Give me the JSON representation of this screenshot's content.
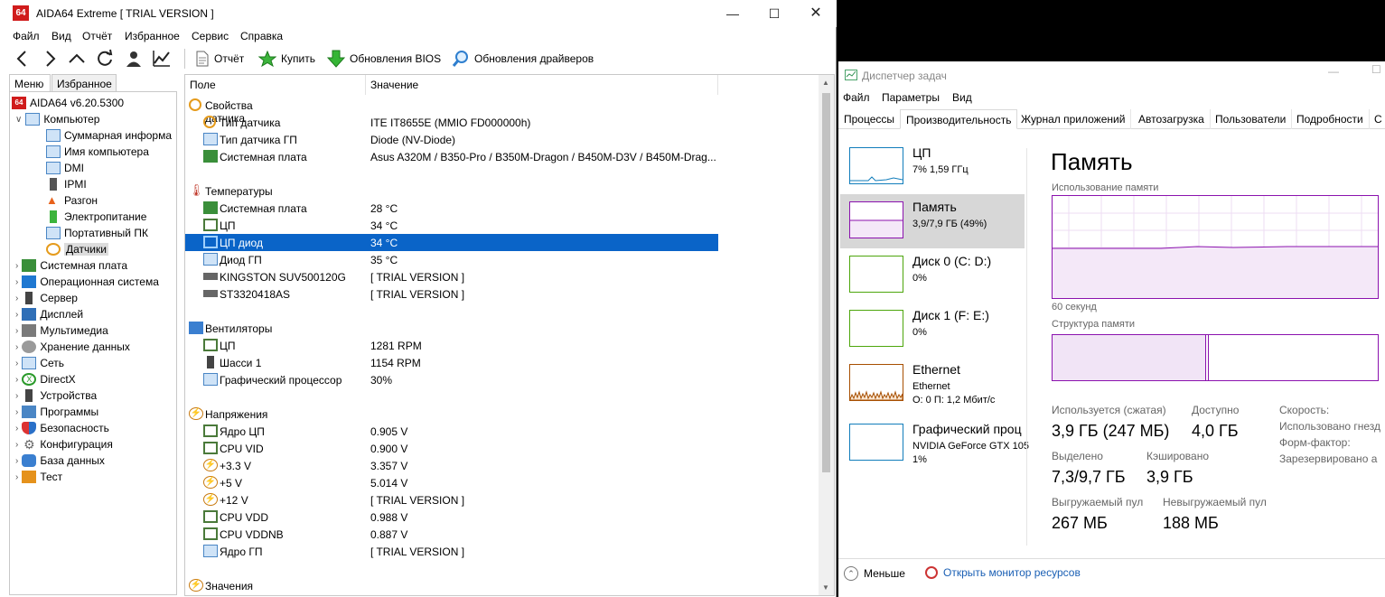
{
  "aida": {
    "title": "AIDA64 Extreme  [ TRIAL VERSION ]",
    "logo": "64",
    "menu": [
      "Файл",
      "Вид",
      "Отчёт",
      "Избранное",
      "Сервис",
      "Справка"
    ],
    "toolbar": {
      "report": "Отчёт",
      "buy": "Купить",
      "bios": "Обновления BIOS",
      "drivers": "Обновления драйверов"
    },
    "left_tabs": [
      "Меню",
      "Избранное"
    ],
    "tree": {
      "root": "AIDA64 v6.20.5300",
      "computer": "Компьютер",
      "children": [
        "Суммарная информа",
        "Имя компьютера",
        "DMI",
        "IPMI",
        "Разгон",
        "Электропитание",
        "Портативный ПК",
        "Датчики"
      ],
      "sections": [
        "Системная плата",
        "Операционная система",
        "Сервер",
        "Дисплей",
        "Мультимедиа",
        "Хранение данных",
        "Сеть",
        "DirectX",
        "Устройства",
        "Программы",
        "Безопасность",
        "Конфигурация",
        "База данных",
        "Тест"
      ]
    },
    "columns": {
      "field": "Поле",
      "value": "Значение"
    },
    "groups": {
      "props": {
        "title": "Свойства датчика",
        "rows": [
          [
            "Тип датчика",
            "ITE IT8655E  (MMIO FD000000h)"
          ],
          [
            "Тип датчика ГП",
            "Diode  (NV-Diode)"
          ],
          [
            "Системная плата",
            "Asus A320M / B350-Pro / B350M-Dragon / B450M-D3V / B450M-Drag..."
          ]
        ]
      },
      "temps": {
        "title": "Температуры",
        "rows": [
          [
            "Системная плата",
            "28 °C"
          ],
          [
            "ЦП",
            "34 °C"
          ],
          [
            "ЦП диод",
            "34 °C"
          ],
          [
            "Диод ГП",
            "35 °C"
          ],
          [
            "KINGSTON SUV500120G",
            "[ TRIAL VERSION ]"
          ],
          [
            "ST3320418AS",
            "[ TRIAL VERSION ]"
          ]
        ]
      },
      "fans": {
        "title": "Вентиляторы",
        "rows": [
          [
            "ЦП",
            "1281 RPM"
          ],
          [
            "Шасси 1",
            "1154 RPM"
          ],
          [
            "Графический процессор",
            "30%"
          ]
        ]
      },
      "volts": {
        "title": "Напряжения",
        "rows": [
          [
            "Ядро ЦП",
            "0.905 V"
          ],
          [
            "CPU VID",
            "0.900 V"
          ],
          [
            "+3.3 V",
            "3.357 V"
          ],
          [
            "+5 V",
            "5.014 V"
          ],
          [
            "+12 V",
            "[ TRIAL VERSION ]"
          ],
          [
            "CPU VDD",
            "0.988 V"
          ],
          [
            "CPU VDDNB",
            "0.887 V"
          ],
          [
            "Ядро ГП",
            "[ TRIAL VERSION ]"
          ]
        ]
      },
      "current": {
        "title": "Значения тока"
      }
    }
  },
  "tm": {
    "title": "Диспетчер задач",
    "menu": [
      "Файл",
      "Параметры",
      "Вид"
    ],
    "tabs": [
      "Процессы",
      "Производительность",
      "Журнал приложений",
      "Автозагрузка",
      "Пользователи",
      "Подробности",
      "С"
    ],
    "items": [
      {
        "name": "ЦП",
        "sub1": "7%  1,59 ГГц",
        "sub2": ""
      },
      {
        "name": "Память",
        "sub1": "3,9/7,9 ГБ (49%)",
        "sub2": ""
      },
      {
        "name": "Диск 0 (C: D:)",
        "sub1": "0%",
        "sub2": ""
      },
      {
        "name": "Диск 1 (F: E:)",
        "sub1": "0%",
        "sub2": ""
      },
      {
        "name": "Ethernet",
        "sub1": "Ethernet",
        "sub2": "О: 0  П: 1,2 Мбит/с"
      },
      {
        "name": "Графический проц",
        "sub1": "NVIDIA GeForce GTX 105",
        "sub2": "1%"
      }
    ],
    "memory": {
      "title": "Память",
      "usage_label": "Использование памяти",
      "time_label": "60 секунд",
      "struct_label": "Структура памяти",
      "used_lbl": "Используется (сжатая)",
      "used_val": "3,9 ГБ (247 МБ)",
      "avail_lbl": "Доступно",
      "avail_val": "4,0 ГБ",
      "committed_lbl": "Выделено",
      "committed_val": "7,3/9,7 ГБ",
      "cached_lbl": "Кэшировано",
      "cached_val": "3,9 ГБ",
      "paged_lbl": "Выгружаемый пул",
      "paged_val": "267 МБ",
      "nonpaged_lbl": "Невыгружаемый пул",
      "nonpaged_val": "188 МБ",
      "speed_lbl": "Скорость:",
      "slots_lbl": "Использовано гнезд",
      "form_lbl": "Форм-фактор:",
      "reserved_lbl": "Зарезервировано а"
    },
    "footer": {
      "less": "Меньше",
      "monitor": "Открыть монитор ресурсов"
    }
  }
}
